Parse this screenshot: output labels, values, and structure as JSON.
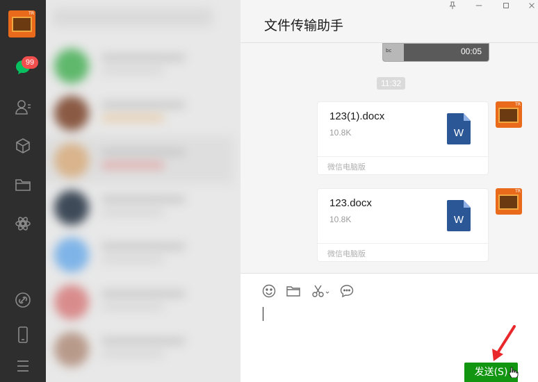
{
  "nav": {
    "avatar_tag": "TR",
    "unread_badge": "99",
    "icons": [
      "chat-icon",
      "contacts-icon",
      "box-icon",
      "folder-icon",
      "moments-icon",
      "link-icon",
      "phone-icon",
      "menu-icon"
    ]
  },
  "chat": {
    "title": "文件传输助手",
    "video": {
      "duration": "00:05",
      "caption": "bc"
    },
    "timestamp": "11:32",
    "messages": [
      {
        "file_name": "123(1).docx",
        "file_size": "10.8K",
        "source": "微信电脑版",
        "file_icon_label": "W"
      },
      {
        "file_name": "123.docx",
        "file_size": "10.8K",
        "source": "微信电脑版",
        "file_icon_label": "W"
      }
    ]
  },
  "input": {
    "send_label": "发送(S)"
  },
  "colors": {
    "nav_bg": "#2e2e2e",
    "send_green": "#129611",
    "badge_red": "#f14e4e",
    "word_blue": "#2b5797"
  }
}
